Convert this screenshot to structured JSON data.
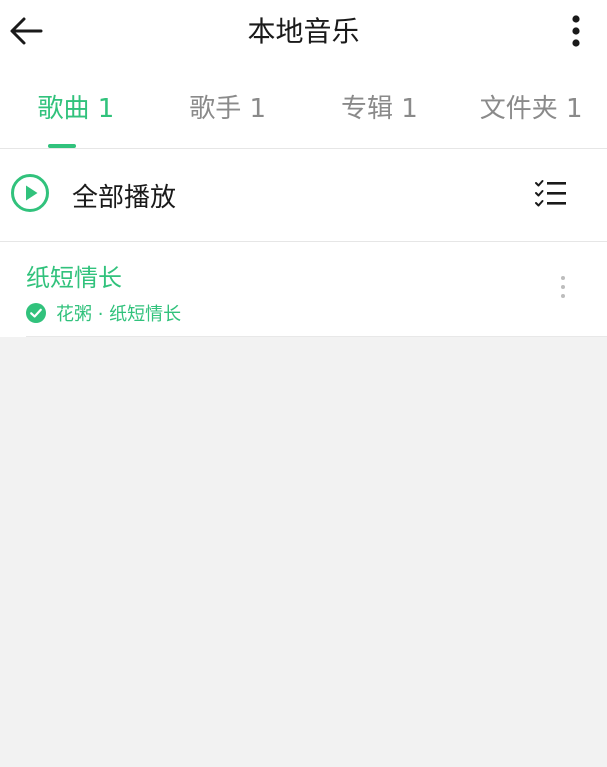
{
  "header": {
    "title": "本地音乐",
    "back_icon": "arrow-left-icon",
    "more_icon": "vertical-dots-icon"
  },
  "tabs": [
    {
      "label": "歌曲 1",
      "active": true
    },
    {
      "label": "歌手 1",
      "active": false
    },
    {
      "label": "专辑 1",
      "active": false
    },
    {
      "label": "文件夹 1",
      "active": false
    }
  ],
  "play_all": {
    "label": "全部播放",
    "play_icon": "play-circle-icon",
    "manage_icon": "list-manage-icon"
  },
  "songs": [
    {
      "title": "纸短情长",
      "subtitle": "花粥 · 纸短情长",
      "status_icon": "check-circle-icon",
      "more_icon": "vertical-dots-icon"
    }
  ],
  "colors": {
    "accent": "#31c27c",
    "text_primary": "#1a1a1a",
    "text_secondary": "#8a8a8a",
    "background": "#f2f2f2"
  }
}
